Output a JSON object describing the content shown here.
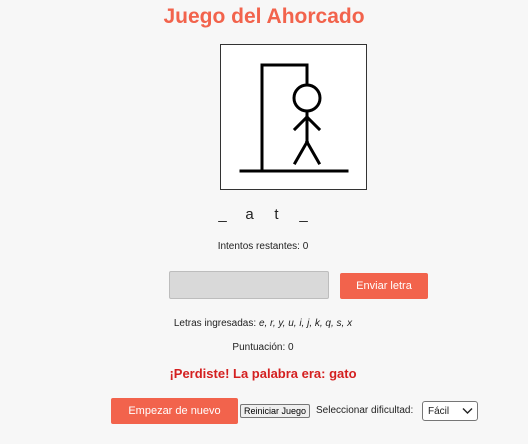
{
  "app": {
    "title": "Juego del Ahorcado"
  },
  "game": {
    "word_letters": [
      "_",
      "a",
      "t",
      "_"
    ],
    "attempts_label": "Intentos restantes: 0",
    "input_value": "",
    "input_placeholder": "",
    "send_label": "Enviar letra",
    "used_label": "Letras ingresadas: ",
    "used_letters": "e, r, y, u, i, j, k, q, s, x",
    "score_label": "Puntuación: 0",
    "result_message": "¡Perdiste! La palabra era: gato",
    "restart_label": "Empezar de nuevo",
    "reset_label": "Reiniciar Juego",
    "difficulty_label": "Seleccionar dificultad:",
    "difficulty_value": "Fácil"
  },
  "colors": {
    "accent": "#f2634c",
    "lost": "#d42020"
  },
  "icons": {
    "select_chevron": "chevron-down-icon"
  }
}
